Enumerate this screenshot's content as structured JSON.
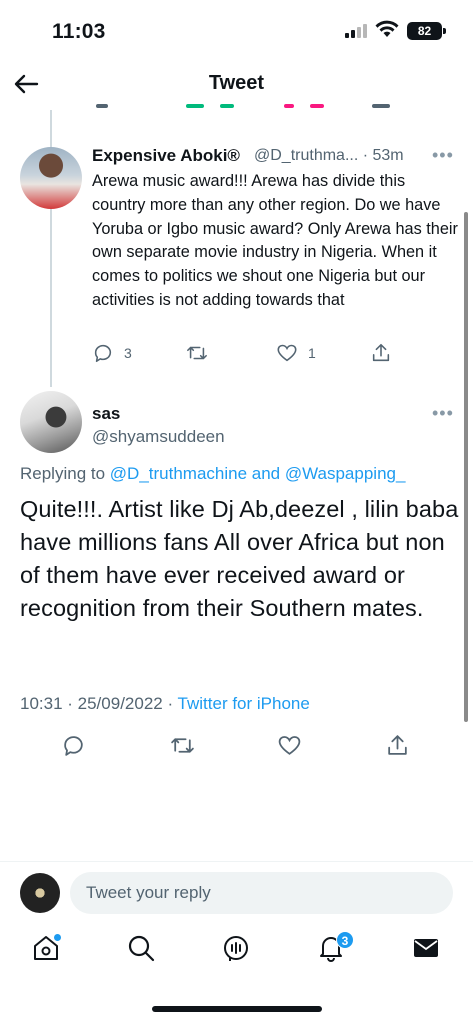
{
  "status_bar": {
    "time": "11:03",
    "battery": "82"
  },
  "header": {
    "title": "Tweet"
  },
  "parent_tweet": {
    "display_name": "Expensive Aboki®",
    "handle_time": "@D_truthma... · 53m",
    "text": "Arewa music award!!! Arewa has divide this country more than any other region. Do we have Yoruba or Igbo music award? Only Arewa has their own separate movie industry in Nigeria. When it comes to politics we shout one Nigeria but our activities is not adding towards that",
    "reply_count": "3",
    "like_count": "1"
  },
  "main_tweet": {
    "display_name": "sas",
    "handle": "@shyamsuddeen",
    "replying_prefix": "Replying to ",
    "replying_to": "@D_truthmachine and @Waspapping_",
    "text": "Quite!!!. Artist like Dj Ab,deezel , lilin baba have millions fans All over Africa but non of them have ever received award or recognition from their Southern mates.",
    "timestamp": "10:31 · 25/09/2022 · ",
    "source": "Twitter for iPhone"
  },
  "reply_bar": {
    "placeholder": "Tweet your reply"
  },
  "nav": {
    "notifications_badge": "3"
  },
  "colors": {
    "accent": "#1d9bf0",
    "secondary_text": "#536471",
    "primary_text": "#0f1419"
  }
}
